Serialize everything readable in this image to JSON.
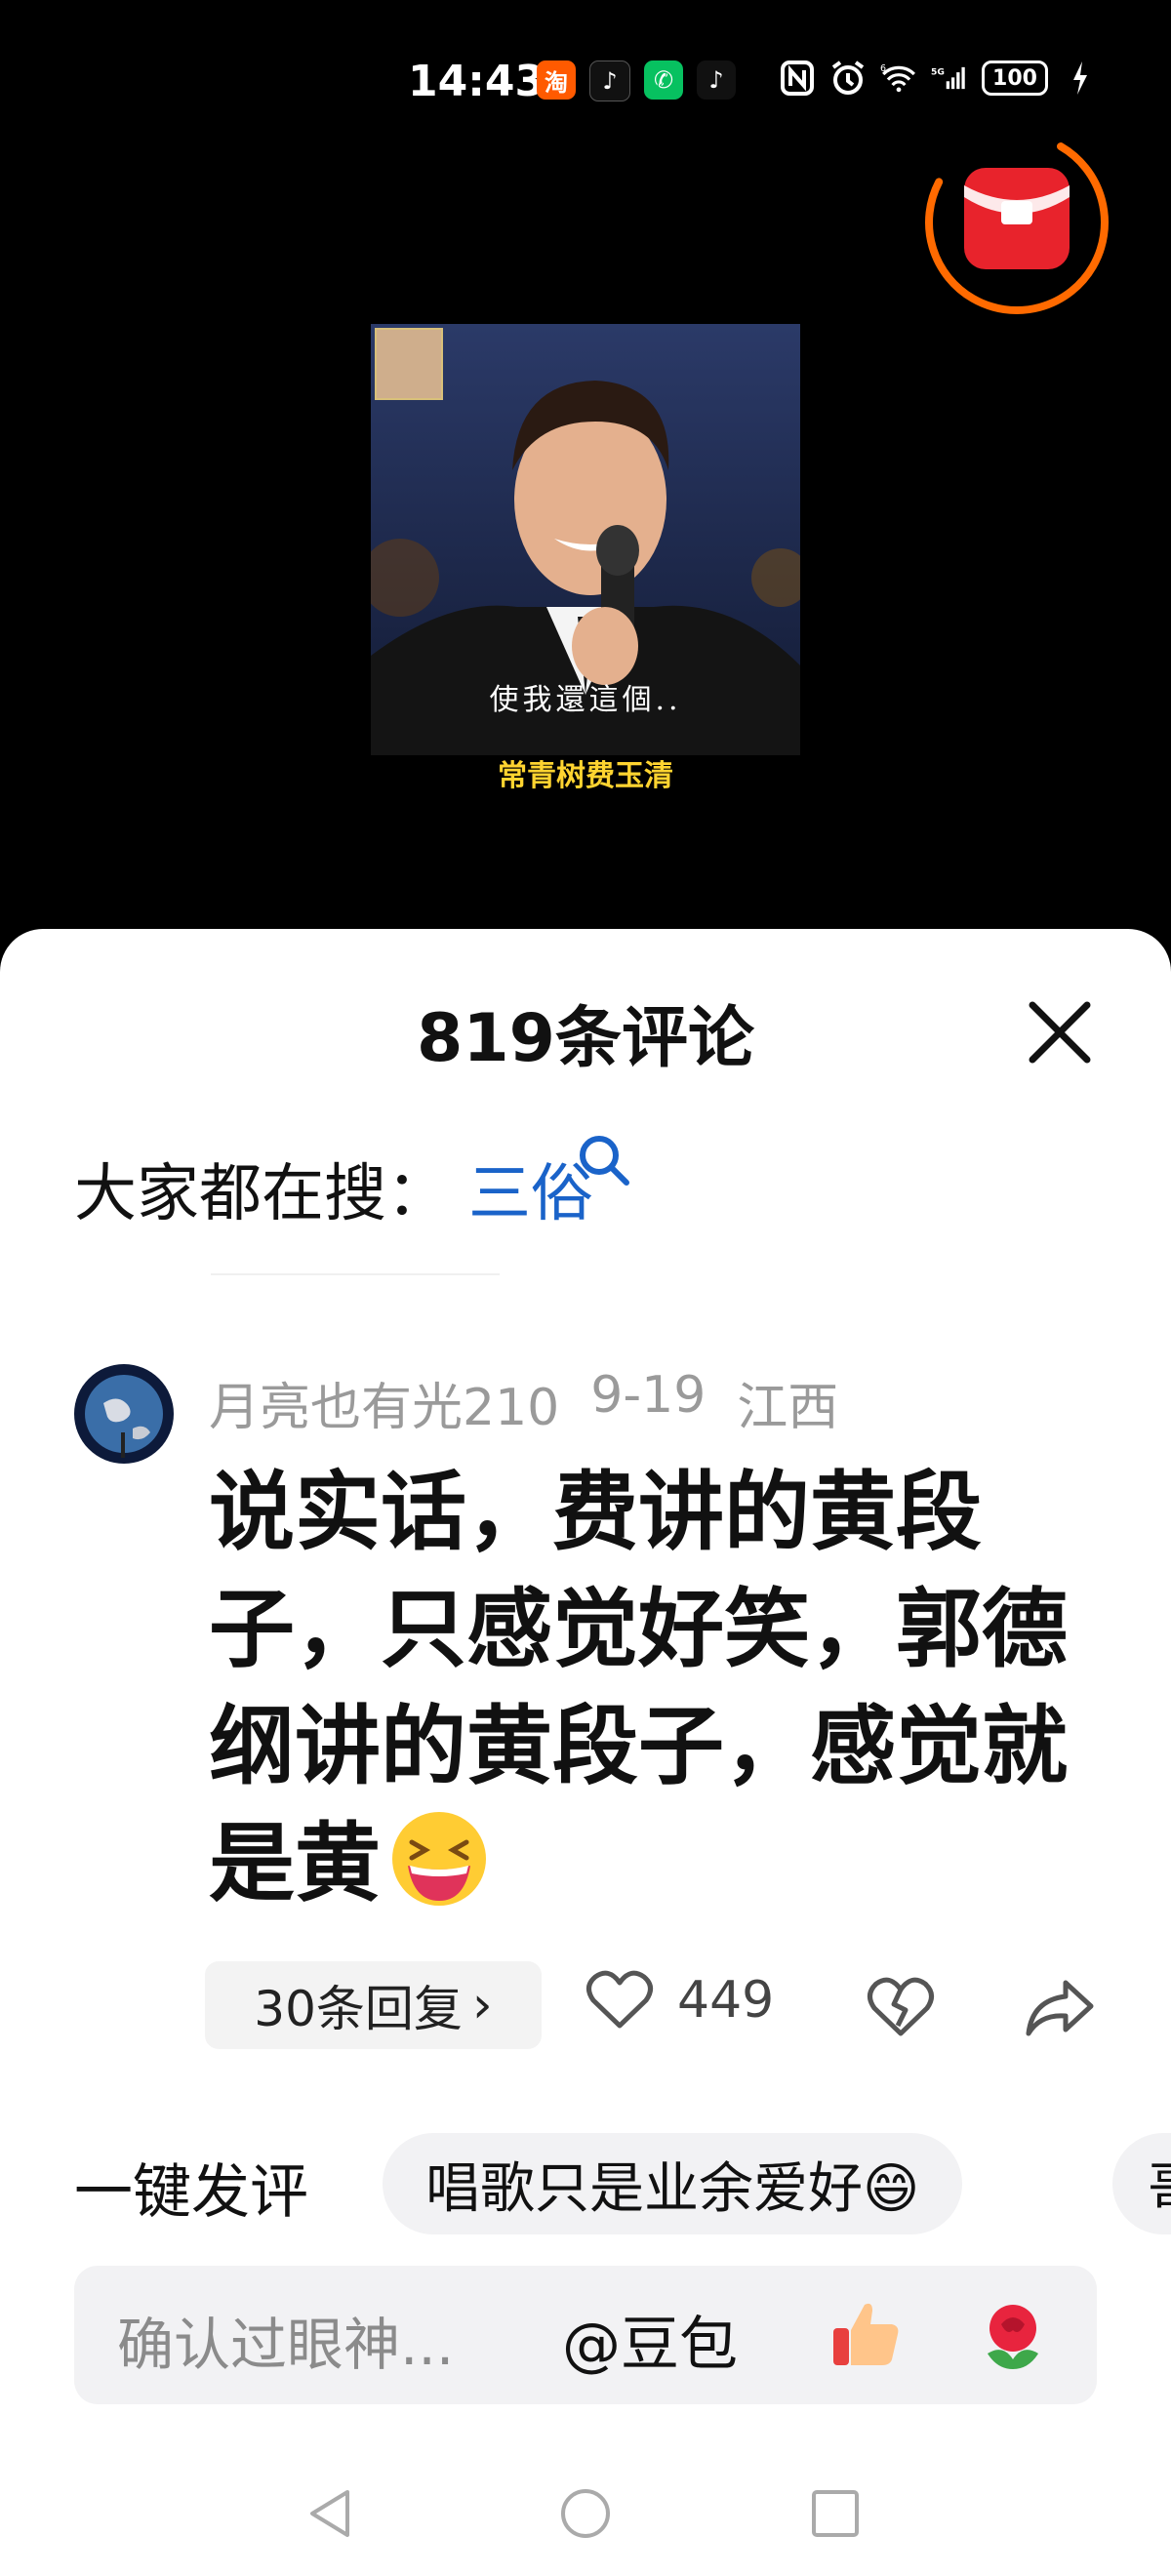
{
  "status_bar": {
    "time": "14:43",
    "app_icons": [
      "taobao-icon",
      "douyin-lite-icon",
      "wechat-icon",
      "tiktok-icon"
    ],
    "app_glyphs": [
      "淘",
      "♪",
      "✆",
      "♪"
    ],
    "network": "5G",
    "wifi_label": "6",
    "battery": "100"
  },
  "video": {
    "subtitle": "使我還這個..",
    "caption": "常青树费玉清"
  },
  "comments_sheet": {
    "title": "819条评论",
    "hot_search_label": "大家都在搜：",
    "hot_search_term": "三俗"
  },
  "comment": {
    "username": "月亮也有光210",
    "date": "9-19",
    "location": "江西",
    "text": "说实话，费讲的黄段子，只感觉好笑，郭德纲讲的黄段子，感觉就是黄",
    "reply_count_label": "30条回复",
    "reply_chevron": "›",
    "like_count": "449"
  },
  "quick_comment": {
    "label": "一键发评",
    "chips": [
      "唱歌只是业余爱好😄",
      "哥"
    ]
  },
  "input": {
    "placeholder": "确认过眼神...",
    "at_label": "@豆包"
  },
  "colors": {
    "link_blue": "#1a63c9",
    "packet_red": "#e8232c",
    "ring_orange": "#ff6a00"
  }
}
